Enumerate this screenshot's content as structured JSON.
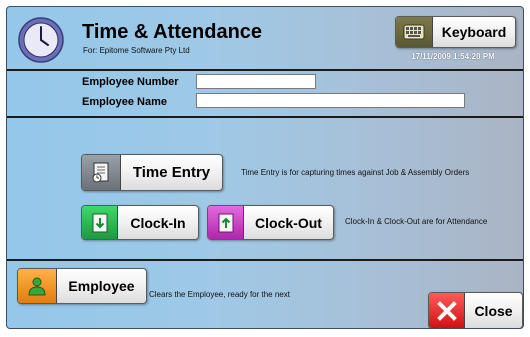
{
  "header": {
    "title": "Time & Attendance",
    "subtitle": "For: Epitome Software Pty Ltd",
    "keyboard_label": "Keyboard",
    "datetime": "17/11/2009 1:54:20 PM"
  },
  "form": {
    "employee_number_label": "Employee Number",
    "employee_number_value": "",
    "employee_name_label": "Employee Name",
    "employee_name_value": ""
  },
  "actions": {
    "time_entry_label": "Time Entry",
    "time_entry_desc": "Time Entry is for capturing times against Job & Assembly Orders",
    "clock_in_label": "Clock-In",
    "clock_out_label": "Clock-Out",
    "clock_desc": "Clock-In & Clock-Out are for Attendance"
  },
  "footer": {
    "employee_label": "Employee",
    "employee_desc": "Clears the Employee, ready for the next",
    "close_label": "Close"
  },
  "icons": {
    "app": "clock-icon",
    "keyboard": "keyboard-icon",
    "time_entry": "timesheet-icon",
    "clock_in": "clock-in-icon",
    "clock_out": "clock-out-icon",
    "employee": "person-icon",
    "close": "close-x-icon"
  },
  "colors": {
    "clock_in": "#2bc451",
    "clock_out": "#cc3fca",
    "employee": "#f59a22",
    "close": "#e82020",
    "keyboard": "#6b6a3c"
  }
}
